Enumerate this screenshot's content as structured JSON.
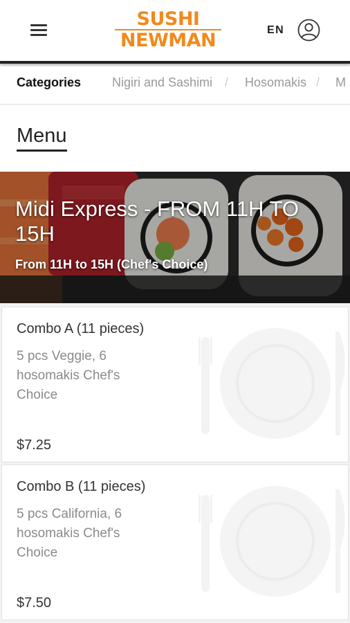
{
  "header": {
    "menu_icon": "hamburger-menu-icon",
    "logo_line1": "SUSHI",
    "logo_line2": "NEWMAN",
    "language": "EN",
    "user_icon": "user-account-icon",
    "brand_color": "#f08a1e"
  },
  "categories": {
    "items": [
      "Categories",
      "Nigiri and Sashimi",
      "Hosomakis",
      "M"
    ],
    "separator": "/"
  },
  "menu": {
    "title": "Menu"
  },
  "banner": {
    "title": "Midi Express - FROM 11H TO 15H",
    "subtitle": "From 11H to 15H (Chef's Choice)"
  },
  "items": [
    {
      "name": "Combo A (11 pieces)",
      "description": "5 pcs Veggie, 6 hosomakis Chef's Choice",
      "price": "$7.25",
      "image_icon": "plate-placeholder-icon"
    },
    {
      "name": "Combo B (11 pieces)",
      "description": "5 pcs California, 6 hosomakis Chef's Choice",
      "price": "$7.50",
      "image_icon": "plate-placeholder-icon"
    }
  ]
}
